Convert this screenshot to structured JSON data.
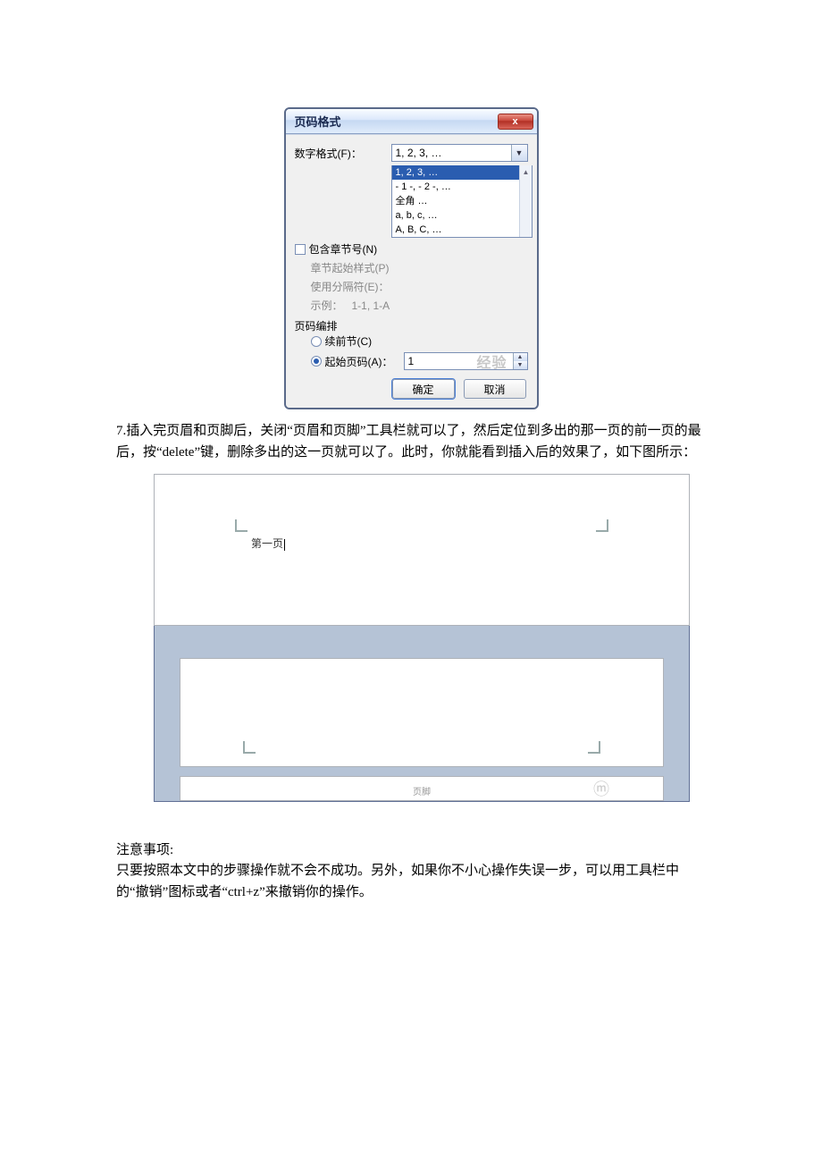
{
  "dialog": {
    "title": "页码格式",
    "close": "x",
    "number_format_label": "数字格式(F)：",
    "number_format_value": "1, 2, 3, …",
    "options": {
      "o1": "1, 2, 3, …",
      "o2": "- 1 -, - 2 -, …",
      "o3": "全角 …",
      "o4": "a, b, c, …",
      "o5": "A, B, C, …"
    },
    "include_chapter_label": "包含章节号(N)",
    "chapter_start_label": "章节起始样式(P)",
    "separator_label": "使用分隔符(E)：",
    "example_label": "示例：",
    "example_value": "1-1, 1-A",
    "group_label": "页码编排",
    "radio_continue": "续前节(C)",
    "radio_start_label": "起始页码(A)：",
    "start_value": "1",
    "ok": "确定",
    "cancel": "取消",
    "watermark": "经验"
  },
  "step7": "7.插入完页眉和页脚后，关闭“页眉和页脚”工具栏就可以了，然后定位到多出的那一页的前一页的最后，按“delete”键，删除多出的这一页就可以了。此时，你就能看到插入后的效果了，如下图所示：",
  "fig2": {
    "header_text": "第一页",
    "footer_text": "页脚"
  },
  "notes_heading": "注意事项:",
  "notes_body": "只要按照本文中的步骤操作就不会不成功。另外，如果你不小心操作失误一步，可以用工具栏中的“撤销”图标或者“ctrl+z”来撤销你的操作。"
}
